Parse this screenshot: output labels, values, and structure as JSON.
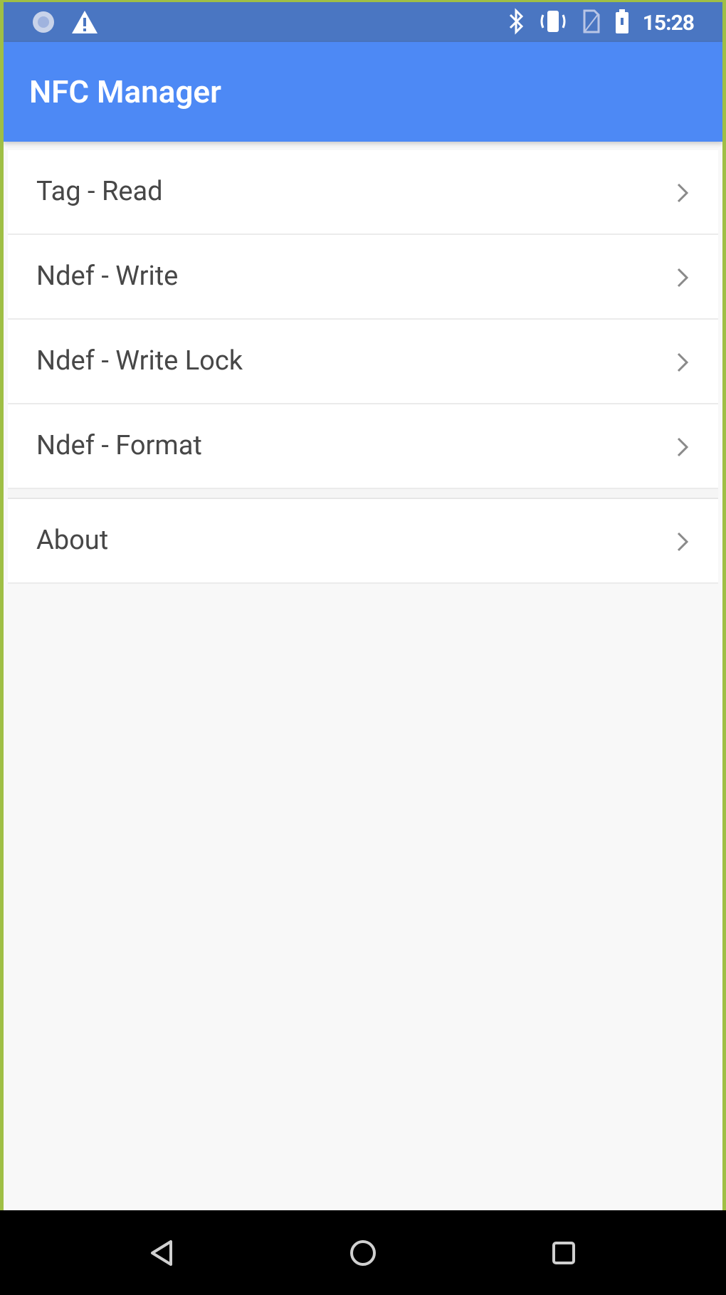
{
  "status_bar": {
    "time": "15:28",
    "left_icons": [
      "signal-dot-icon",
      "warning-icon"
    ],
    "right_icons": [
      "bluetooth-icon",
      "vibrate-icon",
      "no-sim-icon",
      "battery-icon"
    ]
  },
  "app_bar": {
    "title": "NFC Manager",
    "color": "#4d89f5"
  },
  "menu": {
    "items": [
      {
        "label": "Tag - Read"
      },
      {
        "label": "Ndef - Write"
      },
      {
        "label": "Ndef - Write Lock"
      },
      {
        "label": "Ndef - Format"
      }
    ],
    "about": {
      "label": "About"
    }
  },
  "nav_bar": {
    "icons": [
      "back-icon",
      "home-icon",
      "recents-icon"
    ]
  }
}
